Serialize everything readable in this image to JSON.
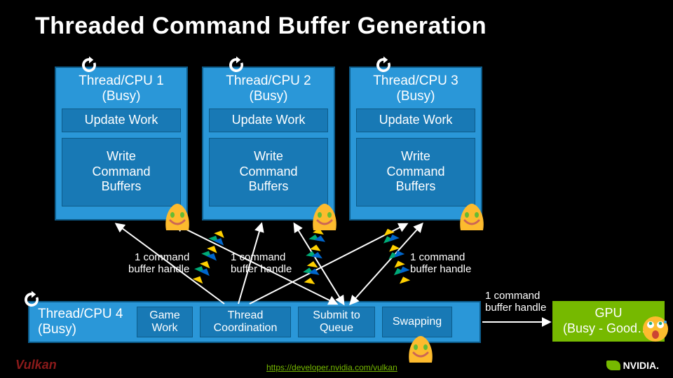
{
  "title": "Threaded Command Buffer Generation",
  "threads": [
    {
      "label_l1": "Thread/CPU 1",
      "label_l2": "(Busy)",
      "update": "Update Work",
      "write": "Write\nCommand\nBuffers"
    },
    {
      "label_l1": "Thread/CPU 2",
      "label_l2": "(Busy)",
      "update": "Update Work",
      "write": "Write\nCommand\nBuffers"
    },
    {
      "label_l1": "Thread/CPU 3",
      "label_l2": "(Busy)",
      "update": "Update Work",
      "write": "Write\nCommand\nBuffers"
    }
  ],
  "bottom": {
    "label_l1": "Thread/CPU 4",
    "label_l2": "(Busy)",
    "tasks": [
      "Game\nWork",
      "Thread\nCoordination",
      "Submit to\nQueue",
      "Swapping"
    ]
  },
  "gpu": {
    "l1": "GPU",
    "l2": "(Busy - Good…)"
  },
  "annot_cmd": "1 command\nbuffer handle",
  "footer": {
    "vulkan": "Vulkan",
    "nvidia": "NVIDIA.",
    "link": "https://developer.nvidia.com/vulkan"
  },
  "colors": {
    "thread_bg": "#2a97d8",
    "thread_inner": "#1879b5",
    "gpu": "#76b900",
    "bg": "#000000"
  }
}
